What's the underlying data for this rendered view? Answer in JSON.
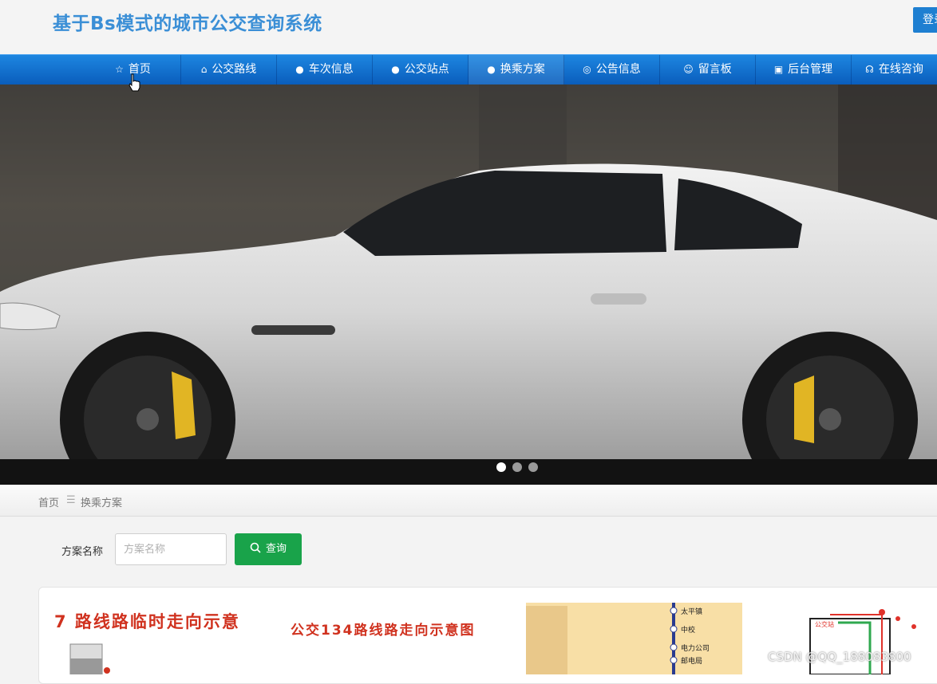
{
  "header": {
    "site_title": "基于Bs模式的城市公交查询系统",
    "login_label": "登录"
  },
  "nav": {
    "items": [
      {
        "label": "首页",
        "icon": "star-icon"
      },
      {
        "label": "公交路线",
        "icon": "bag-icon"
      },
      {
        "label": "车次信息",
        "icon": "info-icon"
      },
      {
        "label": "公交站点",
        "icon": "question-icon"
      },
      {
        "label": "换乘方案",
        "icon": "info-icon"
      },
      {
        "label": "公告信息",
        "icon": "circle-icon"
      },
      {
        "label": "留言板",
        "icon": "smile-icon"
      },
      {
        "label": "后台管理",
        "icon": "briefcase-icon"
      },
      {
        "label": "在线咨询",
        "icon": "headset-icon"
      }
    ],
    "active_index": 4
  },
  "carousel": {
    "slide_count": 3,
    "active_slide": 1
  },
  "breadcrumb": {
    "home": "首页",
    "separator": "☰",
    "current": "换乘方案"
  },
  "search": {
    "label": "方案名称",
    "placeholder": "方案名称",
    "value": "",
    "button_label": "查询"
  },
  "thumbnails": [
    {
      "caption": "7 路线路临时走向示意"
    },
    {
      "caption": "公交134路线路走向示意图"
    },
    {
      "stops": [
        "太平镇",
        "中校",
        "电力公司",
        "邮电局"
      ]
    },
    {
      "label": "公交站"
    }
  ],
  "watermark": "CSDN @QQ_188083800",
  "colors": {
    "brand_blue": "#3b8fd6",
    "nav_blue": "#0a5dbc",
    "search_green": "#19a34a"
  }
}
